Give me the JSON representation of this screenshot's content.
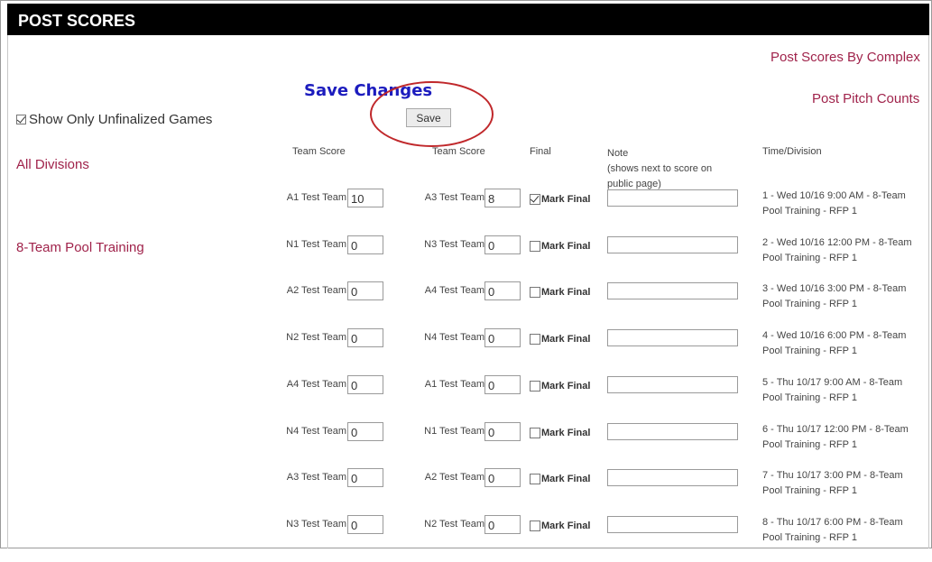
{
  "header": {
    "title": "POST SCORES"
  },
  "links": {
    "post_scores_by_complex": "Post Scores By Complex",
    "post_pitch_counts": "Post Pitch Counts"
  },
  "annotation": {
    "save_changes": "Save Changes",
    "circle_color": "#c0282b"
  },
  "save_button": {
    "label": "Save"
  },
  "filter": {
    "label": "Show Only Unfinalized Games",
    "checked": true
  },
  "sidebar": {
    "all_divisions": "All Divisions",
    "division": "8-Team Pool Training"
  },
  "columns": {
    "team_score_1": "Team Score",
    "team_score_2": "Team Score",
    "final": "Final",
    "note": "Note",
    "note_hint": "(shows next to score on public page)",
    "time_division": "Time/Division"
  },
  "games": [
    {
      "team1": "A1 Test Team",
      "score1": "10",
      "team2": "A3 Test Team",
      "score2": "8",
      "final_checked": true,
      "final_label": "Mark Final",
      "note": "",
      "time": "1 - Wed 10/16 9:00 AM - 8-Team",
      "division": "Pool Training - RFP 1"
    },
    {
      "team1": "N1 Test Team",
      "score1": "0",
      "team2": "N3 Test Team",
      "score2": "0",
      "final_checked": false,
      "final_label": "Mark Final",
      "note": "",
      "time": "2 - Wed 10/16 12:00 PM - 8-Team",
      "division": "Pool Training - RFP 1"
    },
    {
      "team1": "A2 Test Team",
      "score1": "0",
      "team2": "A4 Test Team",
      "score2": "0",
      "final_checked": false,
      "final_label": "Mark Final",
      "note": "",
      "time": "3 - Wed 10/16 3:00 PM - 8-Team",
      "division": "Pool Training - RFP 1"
    },
    {
      "team1": "N2 Test Team",
      "score1": "0",
      "team2": "N4 Test Team",
      "score2": "0",
      "final_checked": false,
      "final_label": "Mark Final",
      "note": "",
      "time": "4 - Wed 10/16 6:00 PM - 8-Team",
      "division": "Pool Training - RFP 1"
    },
    {
      "team1": "A4 Test Team",
      "score1": "0",
      "team2": "A1 Test Team",
      "score2": "0",
      "final_checked": false,
      "final_label": "Mark Final",
      "note": "",
      "time": "5 - Thu 10/17 9:00 AM - 8-Team",
      "division": "Pool Training - RFP 1"
    },
    {
      "team1": "N4 Test Team",
      "score1": "0",
      "team2": "N1 Test Team",
      "score2": "0",
      "final_checked": false,
      "final_label": "Mark Final",
      "note": "",
      "time": "6 - Thu 10/17 12:00 PM - 8-Team",
      "division": "Pool Training - RFP 1"
    },
    {
      "team1": "A3 Test Team",
      "score1": "0",
      "team2": "A2 Test Team",
      "score2": "0",
      "final_checked": false,
      "final_label": "Mark Final",
      "note": "",
      "time": "7 - Thu 10/17 3:00 PM - 8-Team",
      "division": "Pool Training - RFP 1"
    },
    {
      "team1": "N3 Test Team",
      "score1": "0",
      "team2": "N2 Test Team",
      "score2": "0",
      "final_checked": false,
      "final_label": "Mark Final",
      "note": "",
      "time": "8 - Thu 10/17 6:00 PM - 8-Team",
      "division": "Pool Training - RFP 1"
    }
  ]
}
